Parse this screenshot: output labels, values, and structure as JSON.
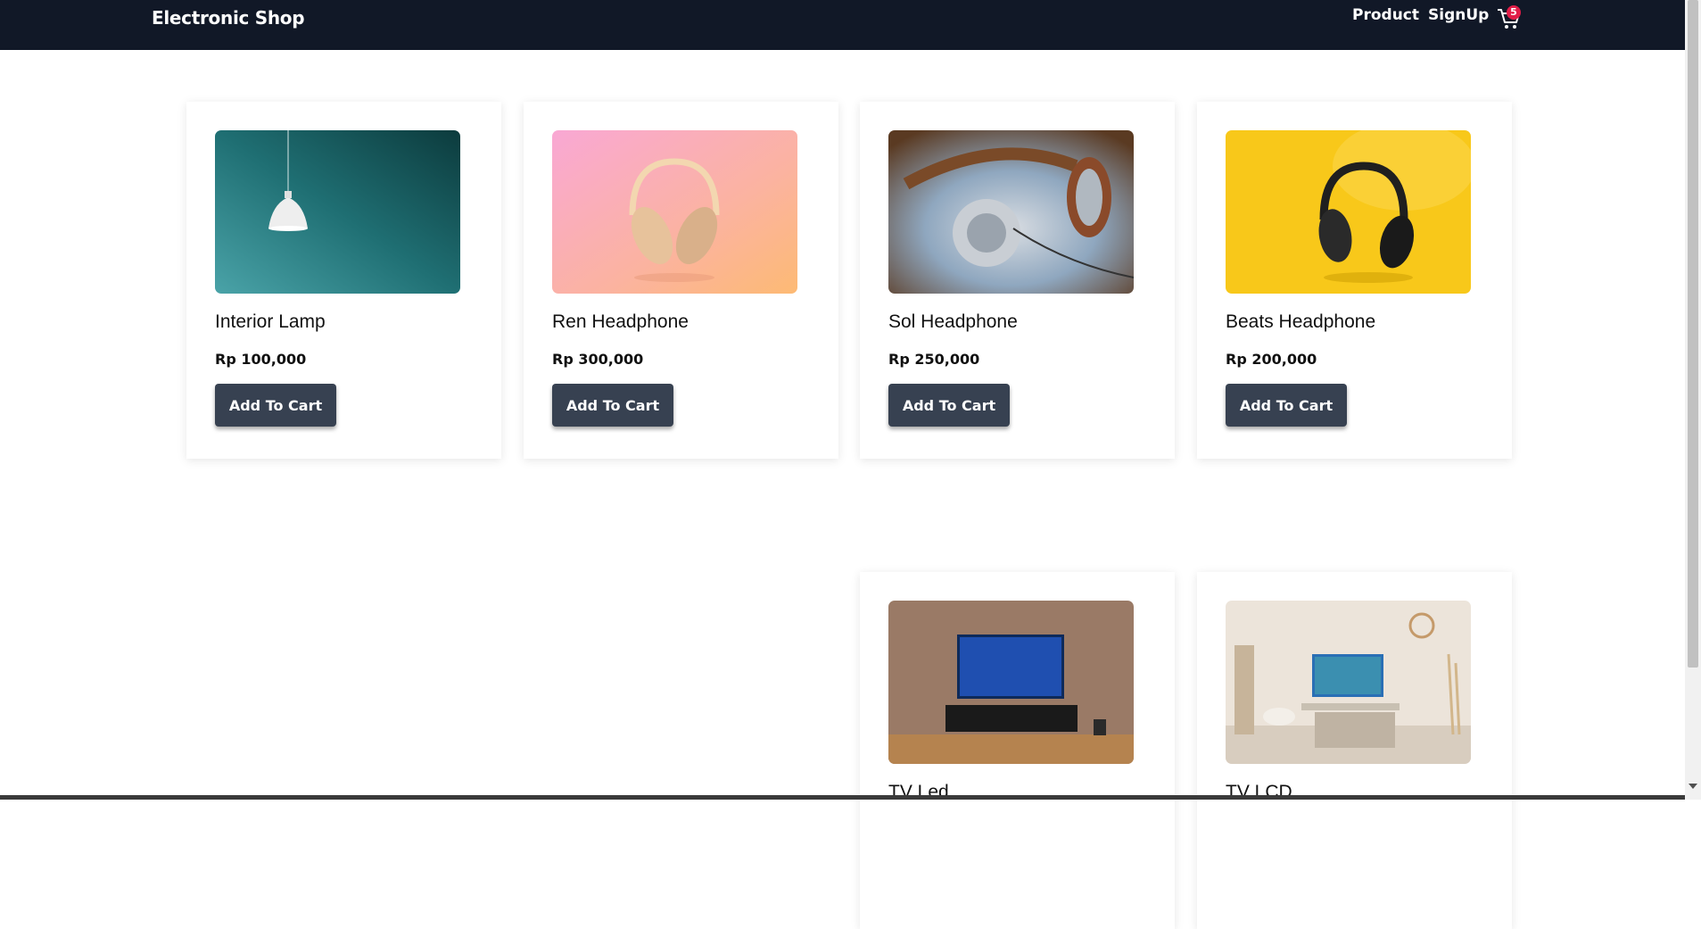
{
  "header": {
    "brand": "Electronic Shop",
    "nav": {
      "product": "Product",
      "signup": "SignUp"
    },
    "cart": {
      "icon": "shopping-cart-icon",
      "count": "5"
    }
  },
  "products": [
    {
      "name": "Interior Lamp",
      "price": "Rp 100,000",
      "button": "Add To Cart",
      "image": "pendant-lamp-photo"
    },
    {
      "name": "Ren Headphone",
      "price": "Rp 300,000",
      "button": "Add To Cart",
      "image": "pink-headphone-photo"
    },
    {
      "name": "Sol Headphone",
      "price": "Rp 250,000",
      "button": "Add To Cart",
      "image": "brown-headphone-photo"
    },
    {
      "name": "Beats Headphone",
      "price": "Rp 200,000",
      "button": "Add To Cart",
      "image": "black-headphone-yellow-photo"
    },
    {
      "name": "TV Led",
      "image": "tv-led-room-photo"
    },
    {
      "name": "TV LCD",
      "image": "tv-lcd-livingroom-photo"
    }
  ],
  "colors": {
    "navbar": "#111827",
    "button": "#374151",
    "badge": "#e11d48"
  }
}
